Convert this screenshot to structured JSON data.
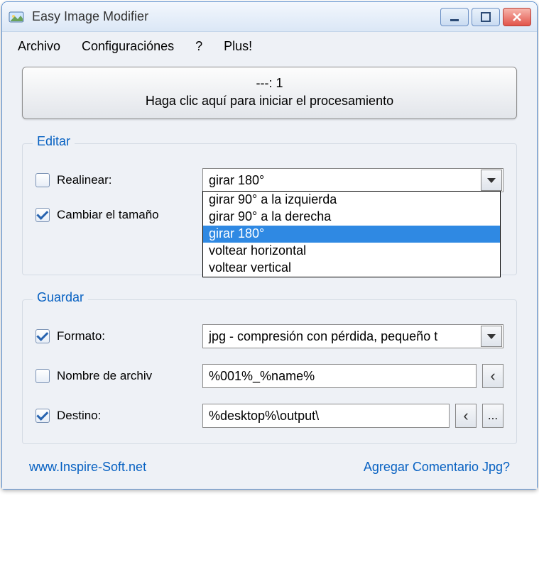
{
  "window": {
    "title": "Easy Image Modifier"
  },
  "menu": {
    "archivo": "Archivo",
    "configuraciones": "Configuraciónes",
    "help": "?",
    "plus": "Plus!"
  },
  "process": {
    "line1": "---: 1",
    "line2": "Haga clic aquí para iniciar el procesamiento"
  },
  "groups": {
    "editar": "Editar",
    "guardar": "Guardar"
  },
  "editar": {
    "realinear_label": "Realinear:",
    "realinear_checked": false,
    "realinear_value": "girar 180°",
    "realinear_options": [
      "girar 90° a la izquierda",
      "girar 90° a la derecha",
      "girar 180°",
      "voltear horizontal",
      "voltear vertical"
    ],
    "realinear_selected_index": 2,
    "cambiar_label": "Cambiar el tamaño",
    "cambiar_checked": true
  },
  "guardar": {
    "formato_label": "Formato:",
    "formato_checked": true,
    "formato_value": "jpg - compresión con pérdida, pequeño t",
    "nombre_label": "Nombre de archiv",
    "nombre_checked": false,
    "nombre_value": "%001%_%name%",
    "destino_label": "Destino:",
    "destino_checked": true,
    "destino_value": "%desktop%\\output\\",
    "browse_label": "..."
  },
  "footer": {
    "website": "www.Inspire-Soft.net",
    "comment": "Agregar Comentario Jpg?"
  }
}
